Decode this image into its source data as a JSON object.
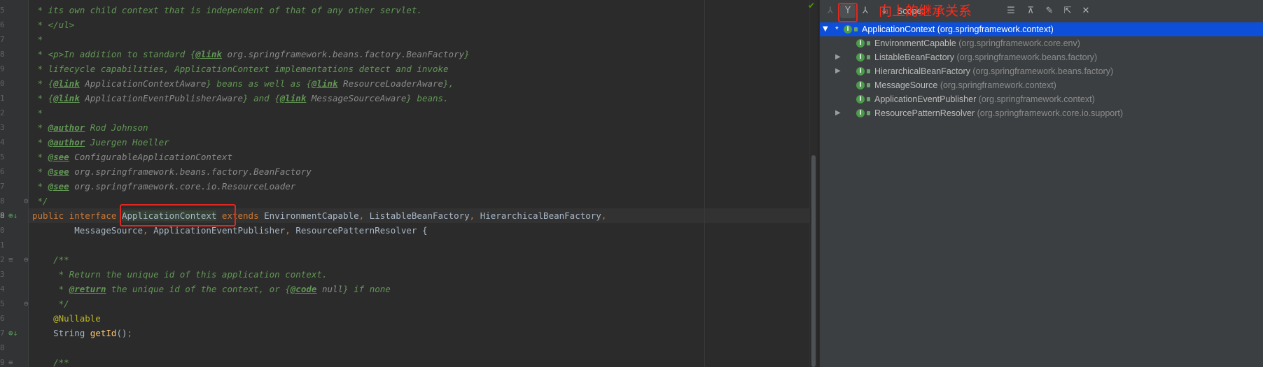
{
  "editor": {
    "lines": [
      [
        {
          "t": " * its own child context that is independent of that of any other servlet.",
          "c": "cm"
        }
      ],
      [
        {
          "t": " * </ul>",
          "c": "cm"
        }
      ],
      [
        {
          "t": " *",
          "c": "cm"
        }
      ],
      [
        {
          "t": " * <p>In addition to standard {",
          "c": "cm"
        },
        {
          "t": "@link",
          "c": "tg"
        },
        {
          "t": " org.springframework.beans.factory.BeanFactory",
          "c": "tv"
        },
        {
          "t": "}",
          "c": "cm"
        }
      ],
      [
        {
          "t": " * lifecycle capabilities, ApplicationContext implementations detect and invoke",
          "c": "cm"
        }
      ],
      [
        {
          "t": " * {",
          "c": "cm"
        },
        {
          "t": "@link",
          "c": "tg"
        },
        {
          "t": " ApplicationContextAware",
          "c": "tv"
        },
        {
          "t": "} beans as well as {",
          "c": "cm"
        },
        {
          "t": "@link",
          "c": "tg"
        },
        {
          "t": " ResourceLoaderAware",
          "c": "tv"
        },
        {
          "t": "},",
          "c": "cm"
        }
      ],
      [
        {
          "t": " * {",
          "c": "cm"
        },
        {
          "t": "@link",
          "c": "tg"
        },
        {
          "t": " ApplicationEventPublisherAware",
          "c": "tv"
        },
        {
          "t": "} and {",
          "c": "cm"
        },
        {
          "t": "@link",
          "c": "tg"
        },
        {
          "t": " MessageSourceAware",
          "c": "tv"
        },
        {
          "t": "} beans.",
          "c": "cm"
        }
      ],
      [
        {
          "t": " *",
          "c": "cm"
        }
      ],
      [
        {
          "t": " * ",
          "c": "cm"
        },
        {
          "t": "@author",
          "c": "tg"
        },
        {
          "t": " Rod Johnson",
          "c": "cm"
        }
      ],
      [
        {
          "t": " * ",
          "c": "cm"
        },
        {
          "t": "@author",
          "c": "tg"
        },
        {
          "t": " Juergen Hoeller",
          "c": "cm"
        }
      ],
      [
        {
          "t": " * ",
          "c": "cm"
        },
        {
          "t": "@see",
          "c": "tg"
        },
        {
          "t": " ConfigurableApplicationContext",
          "c": "tv"
        }
      ],
      [
        {
          "t": " * ",
          "c": "cm"
        },
        {
          "t": "@see",
          "c": "tg"
        },
        {
          "t": " org.springframework.beans.factory.BeanFactory",
          "c": "tv"
        }
      ],
      [
        {
          "t": " * ",
          "c": "cm"
        },
        {
          "t": "@see",
          "c": "tg"
        },
        {
          "t": " org.springframework.core.io.ResourceLoader",
          "c": "tv"
        }
      ],
      [
        {
          "t": " */",
          "c": "cm"
        }
      ],
      [
        {
          "t": "public interface ",
          "c": "kw"
        },
        {
          "t": "ApplicationContext",
          "c": "pl hl-box"
        },
        {
          "t": " extends ",
          "c": "kw"
        },
        {
          "t": "EnvironmentCapable",
          "c": "pl"
        },
        {
          "t": ", ",
          "c": "kw"
        },
        {
          "t": "ListableBeanFactory",
          "c": "pl"
        },
        {
          "t": ", ",
          "c": "kw"
        },
        {
          "t": "HierarchicalBeanFactory",
          "c": "pl"
        },
        {
          "t": ",",
          "c": "kw"
        }
      ],
      [
        {
          "t": "        MessageSource",
          "c": "pl"
        },
        {
          "t": ", ",
          "c": "kw"
        },
        {
          "t": "ApplicationEventPublisher",
          "c": "pl"
        },
        {
          "t": ", ",
          "c": "kw"
        },
        {
          "t": "ResourcePatternResolver {",
          "c": "pl"
        }
      ],
      [
        {
          "t": "",
          "c": "pl"
        }
      ],
      [
        {
          "t": "    /**",
          "c": "cm"
        }
      ],
      [
        {
          "t": "     * Return the unique id of this application context.",
          "c": "cm"
        }
      ],
      [
        {
          "t": "     * ",
          "c": "cm"
        },
        {
          "t": "@return",
          "c": "tg"
        },
        {
          "t": " the unique id of the context, or {",
          "c": "cm"
        },
        {
          "t": "@code",
          "c": "tg"
        },
        {
          "t": " null",
          "c": "tv"
        },
        {
          "t": "} if none",
          "c": "cm"
        }
      ],
      [
        {
          "t": "     */",
          "c": "cm"
        }
      ],
      [
        {
          "t": "    @Nullable",
          "c": "ann"
        }
      ],
      [
        {
          "t": "    String ",
          "c": "pl"
        },
        {
          "t": "getId",
          "c": "fn"
        },
        {
          "t": "()",
          "c": "pl"
        },
        {
          "t": ";",
          "c": "kw"
        }
      ],
      [
        {
          "t": "",
          "c": "pl"
        }
      ],
      [
        {
          "t": "    /**",
          "c": "cm"
        }
      ]
    ],
    "gutter_numbers": [
      "5",
      "6",
      "7",
      "8",
      "9",
      "0",
      "1",
      "2",
      "3",
      "4",
      "5",
      "6",
      "7",
      "8",
      "9",
      "0",
      "1",
      "2",
      "3",
      "4",
      "5",
      "6",
      "7",
      "8",
      "9"
    ],
    "current_line": "8"
  },
  "hierarchy": {
    "toolbar": {
      "scope_label": "Scope:",
      "annotation": "向上的继承关系",
      "buttons": [
        "subtypes-hierarchy-icon",
        "supertypes-hierarchy-icon",
        "class-hierarchy-icon",
        "sort-alphabetically-icon",
        "expand-all-icon",
        "collapse-all-icon",
        "pin-icon",
        "export-icon",
        "close-icon"
      ]
    },
    "items": [
      {
        "name": "ApplicationContext",
        "pkg": "(org.springframework.context)",
        "selected": true,
        "expander": "down",
        "star": true,
        "indent": 0
      },
      {
        "name": "EnvironmentCapable",
        "pkg": "(org.springframework.core.env)",
        "selected": false,
        "expander": "",
        "star": false,
        "indent": 1
      },
      {
        "name": "ListableBeanFactory",
        "pkg": "(org.springframework.beans.factory)",
        "selected": false,
        "expander": "right",
        "star": false,
        "indent": 1
      },
      {
        "name": "HierarchicalBeanFactory",
        "pkg": "(org.springframework.beans.factory)",
        "selected": false,
        "expander": "right",
        "star": false,
        "indent": 1
      },
      {
        "name": "MessageSource",
        "pkg": "(org.springframework.context)",
        "selected": false,
        "expander": "",
        "star": false,
        "indent": 1
      },
      {
        "name": "ApplicationEventPublisher",
        "pkg": "(org.springframework.context)",
        "selected": false,
        "expander": "",
        "star": false,
        "indent": 1
      },
      {
        "name": "ResourcePatternResolver",
        "pkg": "(org.springframework.core.io.support)",
        "selected": false,
        "expander": "right",
        "star": false,
        "indent": 1
      }
    ]
  },
  "colors": {
    "editor_bg": "#2b2b2b",
    "comment": "#629755",
    "keyword": "#cc7832",
    "annotation": "#bbb529",
    "method": "#ffc66d",
    "selection": "#0d4fd9",
    "callout_red": "#e0271f"
  }
}
